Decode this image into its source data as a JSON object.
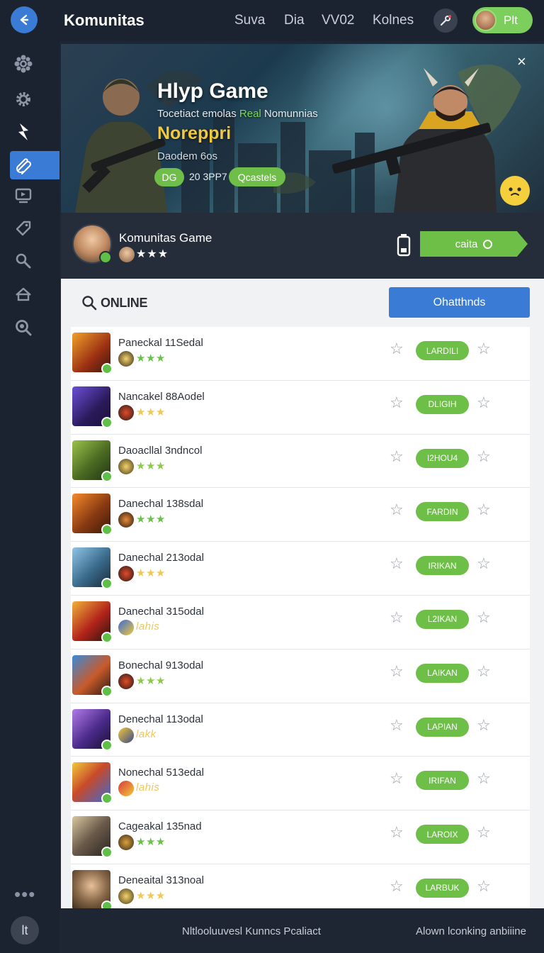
{
  "header": {
    "title": "Komunitas",
    "nav": [
      "Suva",
      "Dia",
      "VV02",
      "Kolnes"
    ],
    "user_label": "Plt"
  },
  "sidebar": {
    "icons": [
      "gear-flower-icon",
      "cog-icon",
      "bolt-icon",
      "link-icon",
      "monitor-icon",
      "tag-icon",
      "search-icon",
      "home-icon",
      "zoom-icon"
    ],
    "active_index": 3,
    "more_label": "•••",
    "bottom_label": "lt"
  },
  "hero": {
    "title": "Hlyp Game",
    "subtitle_pre": "Tocetiact emolas ",
    "subtitle_highlight": "Real",
    "subtitle_post": " Nomunnias",
    "highlight_text": "Noreppri",
    "date_text": "Daodem 6os",
    "badge": "DG",
    "count": "20 3PP7",
    "pill": "Qcastels",
    "close": "×"
  },
  "community": {
    "name": "Komunitas Game",
    "stars": "★★★",
    "cta_label": "caita"
  },
  "panel": {
    "search_label": "ONLINE",
    "button_label": "Ohatthnds"
  },
  "rows": [
    {
      "name": "Paneckal 11Sedal",
      "rating": "★★★",
      "tag": "LARDILI"
    },
    {
      "name": "Nancakel 88Aodel",
      "rating": "★★★",
      "tag": "DLIGIH"
    },
    {
      "name": "Daoacllal 3ndncol",
      "rating": "★★★",
      "tag": "I2HOU4"
    },
    {
      "name": "Danechal 138sdal",
      "rating": "★★★",
      "tag": "FARDIN"
    },
    {
      "name": "Danechal 213odal",
      "rating": "★★★",
      "tag": "IRIKAN"
    },
    {
      "name": "Danechal 315odal",
      "rating": "lahis",
      "tag": "L2IKAN"
    },
    {
      "name": "Bonechal 913odal",
      "rating": "★★★",
      "tag": "LAIKAN"
    },
    {
      "name": "Denechal 113odal",
      "rating": "lakk",
      "tag": "LAPIAN"
    },
    {
      "name": "Nonechal 513edal",
      "rating": "lahis",
      "tag": "IRIFAN"
    },
    {
      "name": "Cageakal 135nad",
      "rating": "★★★",
      "tag": "LAROIX"
    },
    {
      "name": "Deneaital 313noal",
      "rating": "★★★",
      "tag": "LARBUK"
    }
  ],
  "footer": {
    "left": "Nltlooluuvesl Kunncs Pcaliact",
    "right": "Alown lconking anbiiine"
  },
  "colors": {
    "accent_blue": "#3a7bd5",
    "accent_green": "#6dbf47",
    "highlight_yellow": "#f2c93a",
    "background": "#1f2633"
  }
}
